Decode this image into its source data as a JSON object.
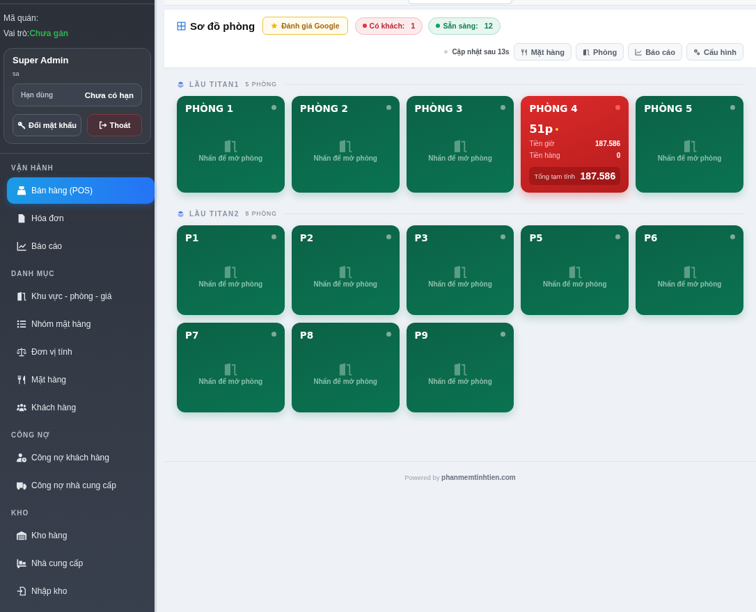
{
  "sidebar": {
    "store_code_label": "Mã quán:",
    "role": {
      "label": "Vai trò:",
      "value": "Chưa gán"
    },
    "user_card": {
      "name": "Super Admin",
      "username": "sa",
      "expiry": {
        "label": "Hạn dùng",
        "value": "Chưa có hạn"
      },
      "buttons": [
        {
          "label": "Đổi mật khẩu",
          "kind": "password"
        },
        {
          "label": "Thoát",
          "kind": "logout"
        }
      ]
    },
    "sections": [
      {
        "title": "VẬN HÀNH",
        "items": [
          {
            "label": "Bán hàng (POS)",
            "selected": true
          },
          {
            "label": "Hóa đơn",
            "selected": false
          },
          {
            "label": "Báo cáo",
            "selected": false
          }
        ]
      },
      {
        "title": "DANH MỤC",
        "items": [
          {
            "label": "Khu vực - phòng - giá",
            "selected": false
          },
          {
            "label": "Nhóm mặt hàng",
            "selected": false
          },
          {
            "label": "Đơn vị tính",
            "selected": false
          },
          {
            "label": "Mặt hàng",
            "selected": false
          },
          {
            "label": "Khách hàng",
            "selected": false
          }
        ]
      },
      {
        "title": "CÔNG NỢ",
        "items": [
          {
            "label": "Công nợ khách hàng",
            "selected": false
          },
          {
            "label": "Công nợ nhà cung cấp",
            "selected": false
          }
        ]
      },
      {
        "title": "KHO",
        "items": [
          {
            "label": "Kho hàng",
            "selected": false
          },
          {
            "label": "Nhà cung cấp",
            "selected": false
          },
          {
            "label": "Nhập kho",
            "selected": false
          }
        ]
      }
    ]
  },
  "header": {
    "title": "Sơ đồ phòng",
    "review_button": "Đánh giá Google",
    "status_badges": [
      {
        "label": "Có khách:",
        "count": "1",
        "color": "#e5333f"
      },
      {
        "label": "Sẵn sàng:",
        "count": "12",
        "color": "#12a064"
      }
    ],
    "refresh_note": "Cập nhật sau 13s",
    "buttons": [
      "Mặt hàng",
      "Phòng",
      "Báo cáo",
      "Cấu hình"
    ]
  },
  "floors": [
    {
      "name": "LẦU TITAN1",
      "room_count": "5 PHÒNG",
      "rooms": [
        {
          "name": "PHÒNG 1",
          "kind": "empty",
          "hint": "Nhấn để mở phòng"
        },
        {
          "name": "PHÒNG 2",
          "kind": "empty",
          "hint": "Nhấn để mở phòng"
        },
        {
          "name": "PHÒNG 3",
          "kind": "empty",
          "hint": "Nhấn để mở phòng"
        },
        {
          "name": "PHÒNG 4",
          "kind": "occupied",
          "elapsed": "51p",
          "lines": [
            {
              "label": "Tiền giờ",
              "value": "187.586"
            },
            {
              "label": "Tiền hàng",
              "value": "0"
            }
          ],
          "total": {
            "label": "Tổng tạm tính",
            "value": "187.586"
          }
        },
        {
          "name": "PHÒNG 5",
          "kind": "empty",
          "hint": "Nhấn để mở phòng"
        }
      ]
    },
    {
      "name": "LẦU TITAN2",
      "room_count": "8 PHÒNG",
      "rooms": [
        {
          "name": "P1",
          "kind": "empty",
          "hint": "Nhấn để mở phòng"
        },
        {
          "name": "P2",
          "kind": "empty",
          "hint": "Nhấn để mở phòng"
        },
        {
          "name": "P3",
          "kind": "empty",
          "hint": "Nhấn để mở phòng"
        },
        {
          "name": "P5",
          "kind": "empty",
          "hint": "Nhấn để mở phòng"
        },
        {
          "name": "P6",
          "kind": "empty",
          "hint": "Nhấn để mở phòng"
        },
        {
          "name": "P7",
          "kind": "empty",
          "hint": "Nhấn để mở phòng"
        },
        {
          "name": "P8",
          "kind": "empty",
          "hint": "Nhấn để mở phòng"
        },
        {
          "name": "P9",
          "kind": "empty",
          "hint": "Nhấn để mở phòng"
        }
      ]
    }
  ],
  "footer": "Powered by **phanmemtinhtien.com**"
}
